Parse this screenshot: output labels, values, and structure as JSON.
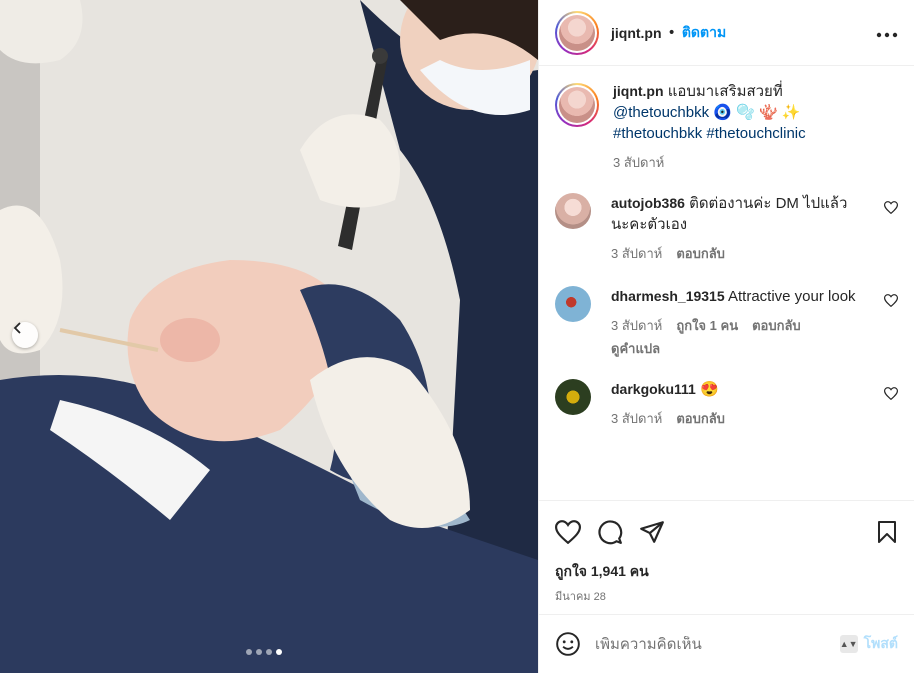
{
  "header": {
    "username": "jiqnt.pn",
    "separator": "•",
    "follow_label": "ติดตาม",
    "more_icon": "more-horizontal-icon"
  },
  "caption": {
    "username": "jiqnt.pn",
    "text": "แอบมาเสริมสวยที่",
    "mention": "@thetouchbkk",
    "emojis": "🧿 🫧 🪸 ✨",
    "hashtags": "#thetouchbkk #thetouchclinic",
    "time": "3 สัปดาห์"
  },
  "comments": [
    {
      "username": "autojob386",
      "text": "ติดต่องานค่ะ DM ไปแล้วนะคะตัวเอง",
      "time": "3 สัปดาห์",
      "likes": "",
      "reply": "ตอบกลับ",
      "translate": ""
    },
    {
      "username": "dharmesh_19315",
      "text": "Attractive your look",
      "time": "3 สัปดาห์",
      "likes": "ถูกใจ 1 คน",
      "reply": "ตอบกลับ",
      "translate": "ดูคำแปล"
    },
    {
      "username": "darkgoku111",
      "text": "😍",
      "time": "3 สัปดาห์",
      "likes": "",
      "reply": "ตอบกลับ",
      "translate": ""
    }
  ],
  "actions": {
    "likes_text": "ถูกใจ 1,941 คน",
    "date": "มีนาคม 28"
  },
  "add_comment": {
    "placeholder": "เพิ่มความคิดเห็น",
    "post_label": "โพสต์"
  },
  "carousel": {
    "count": 4,
    "active_index": 3
  },
  "colors": {
    "accent": "#0095f6",
    "muted": "#737373",
    "post_disabled": "#b2dffc"
  }
}
